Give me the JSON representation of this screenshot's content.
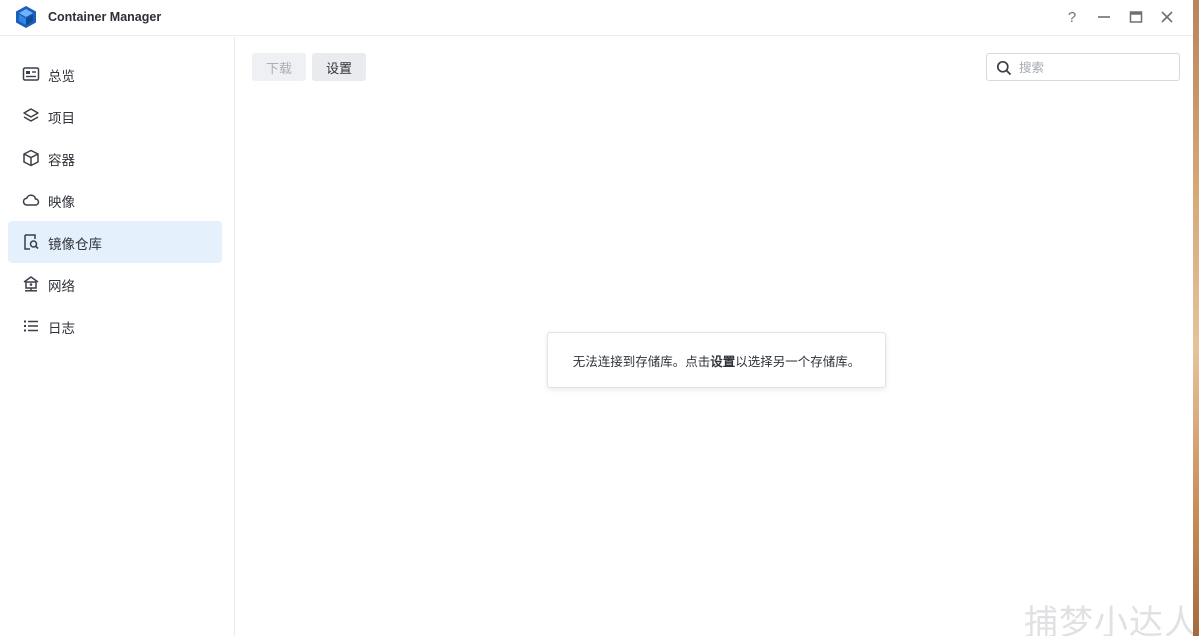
{
  "window": {
    "title": "Container Manager",
    "help_glyph": "?"
  },
  "sidebar": {
    "items": [
      {
        "label": "总览",
        "icon": "overview-card-icon"
      },
      {
        "label": "项目",
        "icon": "layers-icon"
      },
      {
        "label": "容器",
        "icon": "cube-icon"
      },
      {
        "label": "映像",
        "icon": "cloud-icon"
      },
      {
        "label": "镜像仓库",
        "icon": "registry-search-icon",
        "active": true
      },
      {
        "label": "网络",
        "icon": "network-house-icon"
      },
      {
        "label": "日志",
        "icon": "list-icon"
      }
    ]
  },
  "toolbar": {
    "download_label": "下载",
    "settings_label": "设置"
  },
  "search": {
    "placeholder": "搜索",
    "value": ""
  },
  "message": {
    "before": "无法连接到存储库。点击",
    "bold": "设置",
    "after": "以选择另一个存储库。"
  },
  "watermark": "捕梦小达人",
  "colors": {
    "accent": "#1f6fd1",
    "active_bg": "#e4f0fc",
    "text": "#2f333a"
  }
}
